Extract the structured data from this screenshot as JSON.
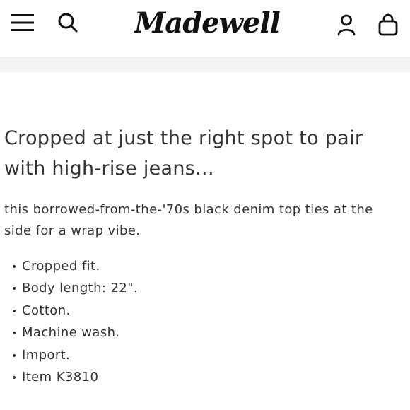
{
  "header": {
    "logo_text": "Madewell",
    "icons": {
      "menu": "hamburger-menu-icon",
      "search": "search-icon",
      "account": "account-icon",
      "bag": "shopping-bag-icon"
    }
  },
  "product": {
    "headline": "Cropped at just the right spot to pair with high-rise jeans...",
    "description": "this borrowed-from-the-'70s black denim top ties at the side for a wrap vibe.",
    "bullet_symbol": "•",
    "features": [
      "Cropped fit.",
      "Body length: 22\".",
      "Cotton.",
      "Machine wash.",
      "Import.",
      "Item K3810"
    ]
  }
}
